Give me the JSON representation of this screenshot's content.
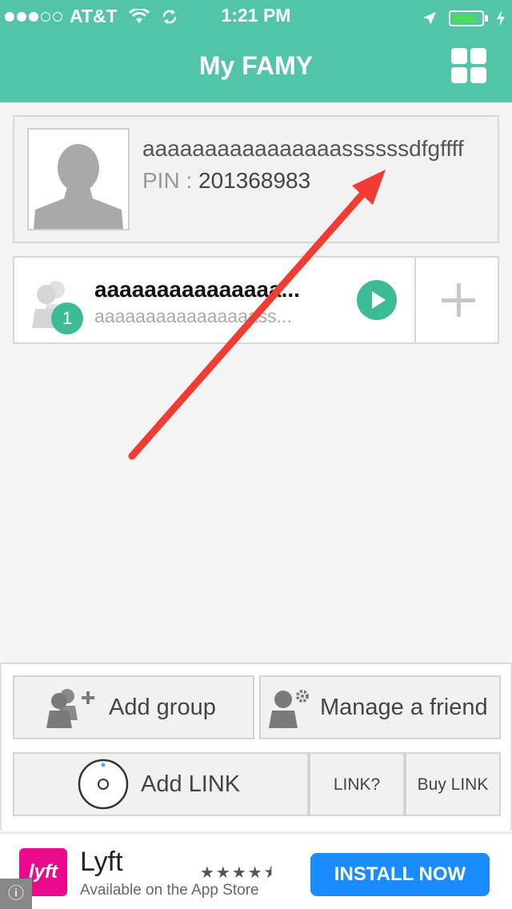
{
  "status_bar": {
    "carrier": "AT&T",
    "time": "1:21 PM",
    "battery_level": 0.85
  },
  "header": {
    "title": "My FAMY"
  },
  "profile": {
    "name": "aaaaaaaaaaaaaaaassssssdfgffff",
    "pin_label": "PIN :",
    "pin": "201368983"
  },
  "group": {
    "title": "aaaaaaaaaaaaaaa...",
    "subtitle": "aaaaaaaaaaaaaaaass...",
    "member_count": "1"
  },
  "actions": {
    "add_group": "Add group",
    "manage_friend": "Manage a friend",
    "add_link": "Add LINK",
    "link_question": "LINK?",
    "buy_link": "Buy LINK"
  },
  "ad": {
    "logo_text": "lyft",
    "name": "Lyft",
    "subtitle": "Available on the App Store",
    "rating": 4.5,
    "cta": "INSTALL NOW"
  },
  "colors": {
    "accent": "#52c4a8",
    "badge": "#3dbb96",
    "arrow": "#f03c32",
    "lyft": "#ea0b8c",
    "install": "#1a8cff"
  }
}
